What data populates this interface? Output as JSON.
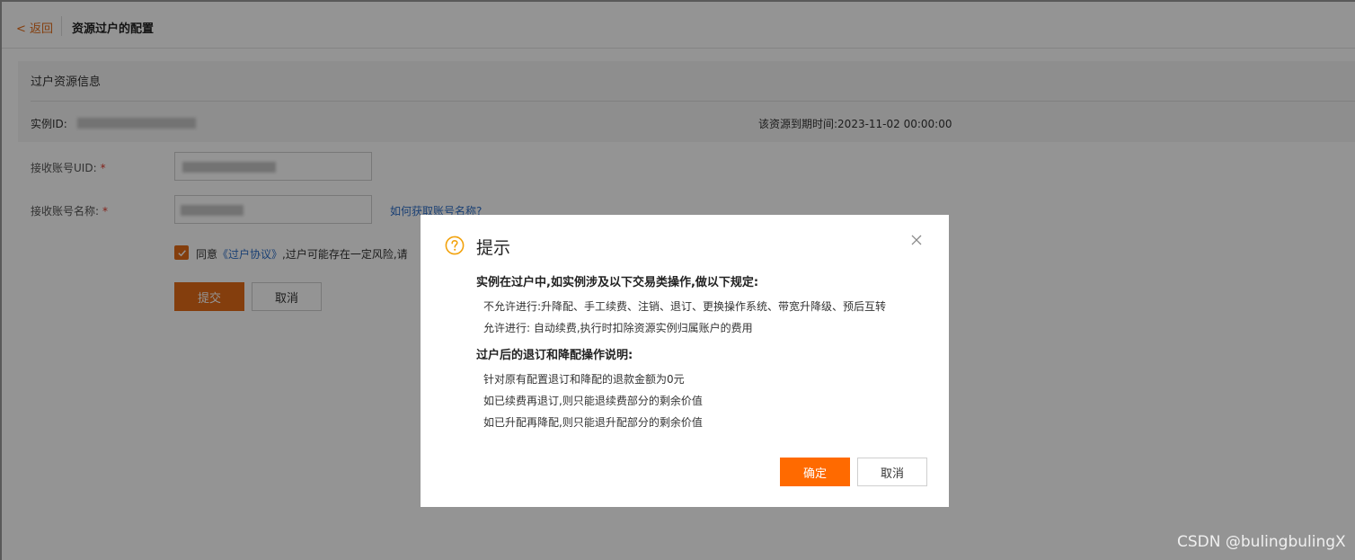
{
  "header": {
    "back_label": "< 返回",
    "title": "资源过户的配置"
  },
  "info_panel": {
    "title": "过户资源信息",
    "instance_id_label": "实例ID:",
    "expire_label": "该资源到期时间:",
    "expire_value": "2023-11-02 00:00:00"
  },
  "form": {
    "uid_label": "接收账号UID:",
    "name_label": "接收账号名称:",
    "required_mark": "*",
    "help_link": "如何获取账号名称?",
    "agree_prefix": "同意",
    "agree_link": "《过户协议》",
    "agree_suffix": ",过户可能存在一定风险,请",
    "submit_label": "提交",
    "cancel_label": "取消"
  },
  "modal": {
    "title": "提示",
    "section1_heading": "实例在过户中,如实例涉及以下交易类操作,做以下规定:",
    "section1_items": [
      "不允许进行:升降配、手工续费、注销、退订、更换操作系统、带宽升降级、预后互转",
      "允许进行: 自动续费,执行时扣除资源实例归属账户的费用"
    ],
    "section2_heading": "过户后的退订和降配操作说明:",
    "section2_items": [
      "针对原有配置退订和降配的退款金额为0元",
      "如已续费再退订,则只能退续费部分的剩余价值",
      "如已升配再降配,则只能退升配部分的剩余价值"
    ],
    "confirm_label": "确定",
    "cancel_label": "取消"
  },
  "watermark": "CSDN @bulingbulingX",
  "colors": {
    "accent": "#e36b17",
    "link": "#2e6fc8",
    "modal_icon": "#f2a20c"
  },
  "icons": {
    "modal": "question-circle-icon",
    "close": "close-icon",
    "checkbox": "checkmark-icon"
  }
}
